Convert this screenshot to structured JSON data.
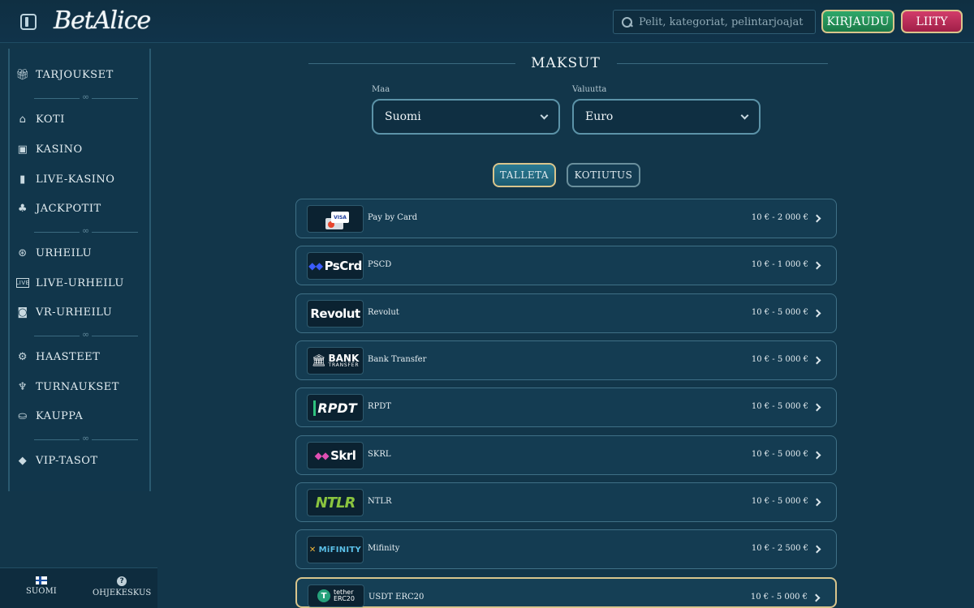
{
  "header": {
    "logo": "BetAlice",
    "search_placeholder": "Pelit, kategoriat, pelintarjoajat",
    "login_label": "KIRJAUDU",
    "join_label": "LIITY"
  },
  "sidebar": {
    "items": [
      {
        "label": "TARJOUKSET",
        "icon": "gift-icon"
      },
      {
        "label": "KOTI",
        "icon": "home-icon"
      },
      {
        "label": "KASINO",
        "icon": "slot-machine-icon"
      },
      {
        "label": "LIVE-KASINO",
        "icon": "cards-icon"
      },
      {
        "label": "JACKPOTIT",
        "icon": "clover-icon"
      },
      {
        "label": "URHEILU",
        "icon": "ball-icon"
      },
      {
        "label": "LIVE-URHEILU",
        "icon": "live-icon"
      },
      {
        "label": "VR-URHEILU",
        "icon": "vr-icon"
      },
      {
        "label": "HAASTEET",
        "icon": "challenge-icon"
      },
      {
        "label": "TURNAUKSET",
        "icon": "trophy-icon"
      },
      {
        "label": "KAUPPA",
        "icon": "basket-icon"
      },
      {
        "label": "VIP-TASOT",
        "icon": "diamond-icon"
      }
    ],
    "bottom": {
      "language_label": "SUOMI",
      "help_label": "OHJEKESKUS"
    }
  },
  "main": {
    "title": "MAKSUT",
    "country_label": "Maa",
    "country_value": "Suomi",
    "currency_label": "Valuutta",
    "currency_value": "Euro",
    "tabs": {
      "deposit": "TALLETA",
      "withdraw": "KOTIUTUS"
    },
    "methods": [
      {
        "name": "Pay by Card",
        "limit": "10 € - 2 000 €",
        "logo_text": "VISA"
      },
      {
        "name": "PSCD",
        "limit": "10 € - 1 000 €",
        "logo_text": "PsCrd"
      },
      {
        "name": "Revolut",
        "limit": "10 € - 5 000 €",
        "logo_text": "Revolut"
      },
      {
        "name": "Bank Transfer",
        "limit": "10 € - 5 000 €",
        "logo_text": "BANK",
        "logo_sub": "TRANSFER"
      },
      {
        "name": "RPDT",
        "limit": "10 € - 5 000 €",
        "logo_text": "RPDT"
      },
      {
        "name": "SKRL",
        "limit": "10 € - 5 000 €",
        "logo_text": "Skrl"
      },
      {
        "name": "NTLR",
        "limit": "10 € - 5 000 €",
        "logo_text": "NTLR"
      },
      {
        "name": "Mifinity",
        "limit": "10 € - 2 500 €",
        "logo_text": "MiFINITY"
      },
      {
        "name": "USDT ERC20",
        "limit": "10 € - 5 000 €",
        "logo_text": "tether",
        "logo_sub": "ERC20"
      }
    ]
  }
}
